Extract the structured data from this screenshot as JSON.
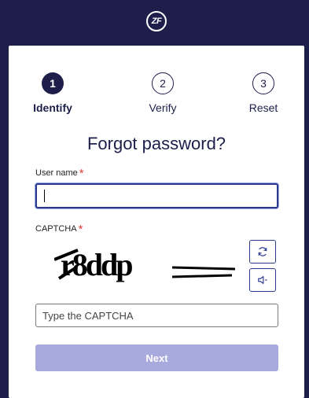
{
  "header": {
    "logo_text": "ZF"
  },
  "stepper": {
    "steps": [
      {
        "number": "1",
        "label": "Identify"
      },
      {
        "number": "2",
        "label": "Verify"
      },
      {
        "number": "3",
        "label": "Reset"
      }
    ],
    "active_step": "1"
  },
  "form": {
    "title": "Forgot password?",
    "username": {
      "label": "User name",
      "required_mark": "*",
      "value": ""
    },
    "captcha": {
      "label": "CAPTCHA",
      "required_mark": "*",
      "image_text": "r8ddp",
      "placeholder": "Type the CAPTCHA",
      "value": ""
    },
    "next_label": "Next"
  },
  "colors": {
    "brand_navy": "#1d1f4a",
    "required_red": "#e53935",
    "button_disabled": "#a8aade",
    "input_focus_border": "#2a3a8c"
  },
  "icons": [
    "refresh-icon",
    "speaker-icon"
  ]
}
